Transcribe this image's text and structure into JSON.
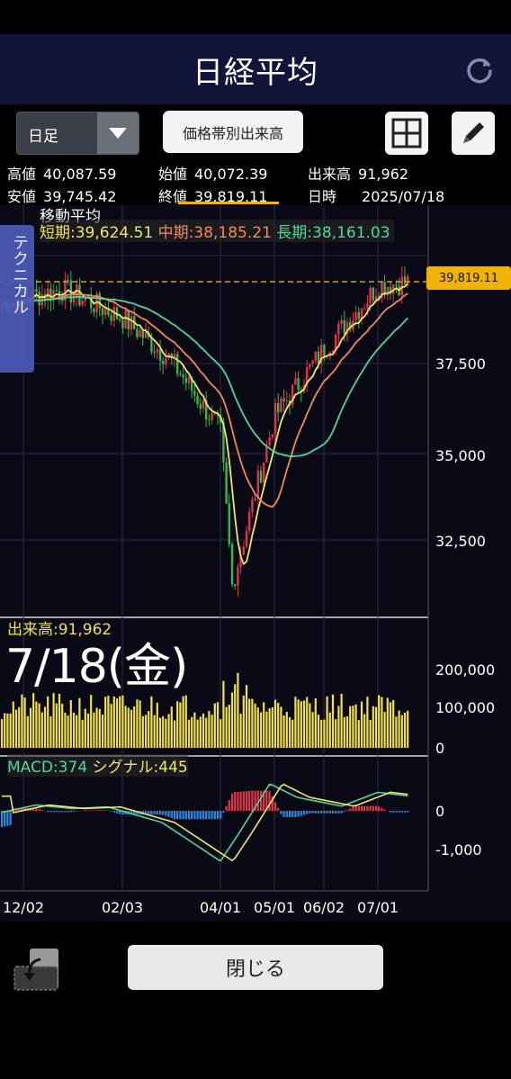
{
  "header": {
    "title": "日経平均"
  },
  "toolbar": {
    "period_selected": "日足",
    "volume_by_price_label": "価格帯別出来高"
  },
  "quotes": {
    "high_label": "高値",
    "high": "40,087.59",
    "low_label": "安値",
    "low": "39,745.42",
    "open_label": "始値",
    "open": "40,072.39",
    "close_label": "終値",
    "close": "39,819.11",
    "volume_label": "出来高",
    "volume": "91,962",
    "date_label": "日時",
    "date": "2025/07/18"
  },
  "technical_tab": "テクニカル",
  "moving_average": {
    "title": "移動平均",
    "short": "短期:39,624.51",
    "mid": "中期:38,185.21",
    "long": "長期:38,161.03"
  },
  "price_badge": "39,819.11",
  "volume_panel": {
    "label": "出来高:91,962"
  },
  "selected_date": "7/18(金)",
  "macd_panel": {
    "macd": "MACD:374",
    "signal": "シグナル:445"
  },
  "close_button": "閉じる",
  "colors": {
    "short_ma": "#f0e66a",
    "mid_ma": "#f08a5a",
    "long_ma": "#4fd6a0",
    "candle_up": "#e0344a",
    "candle_down": "#38b84a",
    "volume": "#f0e04a",
    "badge": "#f0b400",
    "header_bg": "#12143a"
  },
  "chart_data": [
    {
      "type": "candlestick",
      "title": "日経平均",
      "y_ticks": [
        "37,500",
        "35,000",
        "32,500"
      ],
      "x_ticks": [
        "12/02",
        "02/03",
        "04/01",
        "05/01",
        "06/02",
        "07/01"
      ],
      "last_close": 39819.11,
      "series": [
        {
          "name": "短期",
          "last": 39624.51
        },
        {
          "name": "中期",
          "last": 38185.21
        },
        {
          "name": "長期",
          "last": 38161.03
        }
      ],
      "approx_path": {
        "x": [
          "12/02",
          "01/06",
          "02/03",
          "03/03",
          "04/01",
          "04/07",
          "05/01",
          "06/02",
          "07/01",
          "07/18"
        ],
        "close": [
          39200,
          39600,
          38800,
          37600,
          35600,
          31200,
          36000,
          37900,
          39700,
          39819
        ]
      }
    },
    {
      "type": "bar",
      "title": "出来高",
      "y_ticks": [
        "200,000",
        "100,000",
        "0"
      ],
      "last": 91962
    },
    {
      "type": "line",
      "title": "MACD",
      "y_ticks": [
        "0",
        "-1,000"
      ],
      "series": [
        {
          "name": "MACD",
          "last": 374
        },
        {
          "name": "シグナル",
          "last": 445
        }
      ]
    }
  ]
}
